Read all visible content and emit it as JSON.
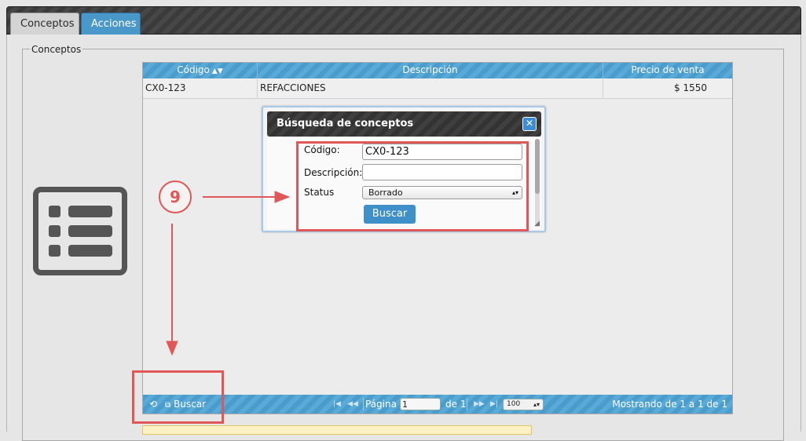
{
  "tabs": [
    {
      "label": "Conceptos"
    },
    {
      "label": "Acciones"
    }
  ],
  "section": {
    "legend": "Conceptos"
  },
  "grid": {
    "columns": [
      {
        "label": "Código",
        "sortable": true
      },
      {
        "label": "Descripción"
      },
      {
        "label": "Precio de venta"
      }
    ],
    "rows": [
      {
        "codigo": "CX0-123",
        "descripcion": "REFACCIONES",
        "precio": "$ 1550"
      }
    ],
    "footer": {
      "search_label": "Buscar",
      "page_label": "Página",
      "page_value": "1",
      "of_label": "de 1",
      "rows_per_page": "100",
      "showing": "Mostrando de 1 a 1 de 1"
    }
  },
  "dialog": {
    "title": "Búsqueda de conceptos",
    "fields": {
      "codigo_label": "Código:",
      "codigo_value": "CX0-123",
      "descripcion_label": "Descripción:",
      "descripcion_value": "",
      "status_label": "Status",
      "status_value": "Borrado"
    },
    "search_button": "Buscar"
  },
  "annotation": {
    "step_number": "9",
    "color": "#e05757"
  },
  "colors": {
    "accent": "#4a98c9",
    "dark_header": "#333333"
  }
}
